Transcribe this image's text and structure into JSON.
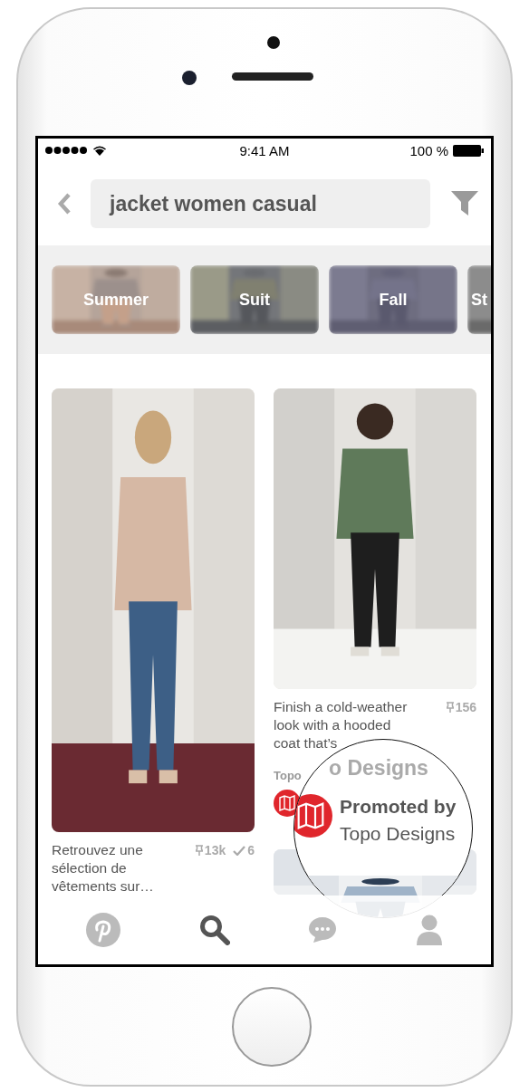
{
  "status_bar": {
    "time": "9:41 AM",
    "battery": "100 %"
  },
  "search": {
    "value": "jacket women casual"
  },
  "chips": [
    {
      "label": "Summer",
      "kind": "full"
    },
    {
      "label": "Suit",
      "kind": "full"
    },
    {
      "label": "Fall",
      "kind": "full"
    },
    {
      "label": "St",
      "kind": "cut"
    }
  ],
  "pins": [
    {
      "description": "Retrouvez une sélection de vêtements sur…",
      "saves": "13k",
      "tries": "6"
    },
    {
      "description": "Finish a cold-weather look with a hooded coat that’s",
      "saves": "156",
      "source": "Topo"
    }
  ],
  "promo_lens": {
    "heading": "o Designs",
    "label": "Promoted by",
    "advertiser": "Topo Designs"
  },
  "tab_bar": [
    {
      "kind": "home",
      "selected": false
    },
    {
      "kind": "search",
      "selected": true
    },
    {
      "kind": "messages",
      "selected": false
    },
    {
      "kind": "profile",
      "selected": false
    }
  ]
}
